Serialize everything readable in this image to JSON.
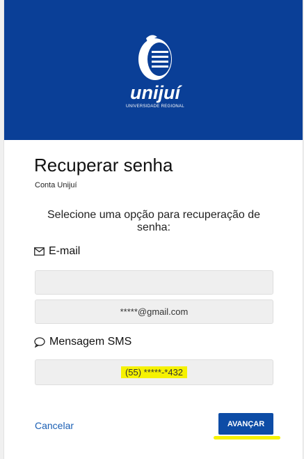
{
  "header": {
    "logo_text": "unijuí",
    "logo_subtext": "UNIVERSIDADE REGIONAL",
    "banner_color": "#0a3f97"
  },
  "page": {
    "title": "Recuperar senha",
    "subtitle": "Conta Unijuí",
    "instruction": "Selecione uma opção para recuperação de senha:"
  },
  "email_section": {
    "label": "E-mail",
    "icon": "envelope-icon",
    "options": [
      {
        "value": ""
      },
      {
        "value": "*****@gmail.com"
      }
    ]
  },
  "sms_section": {
    "label": "Mensagem SMS",
    "icon": "speech-bubble-icon",
    "options": [
      {
        "value": "(55) *****-*432"
      }
    ]
  },
  "actions": {
    "cancel_label": "Cancelar",
    "next_label": "AVANÇAR",
    "accent": "#0d4ca6",
    "highlight": "#f6f200"
  }
}
